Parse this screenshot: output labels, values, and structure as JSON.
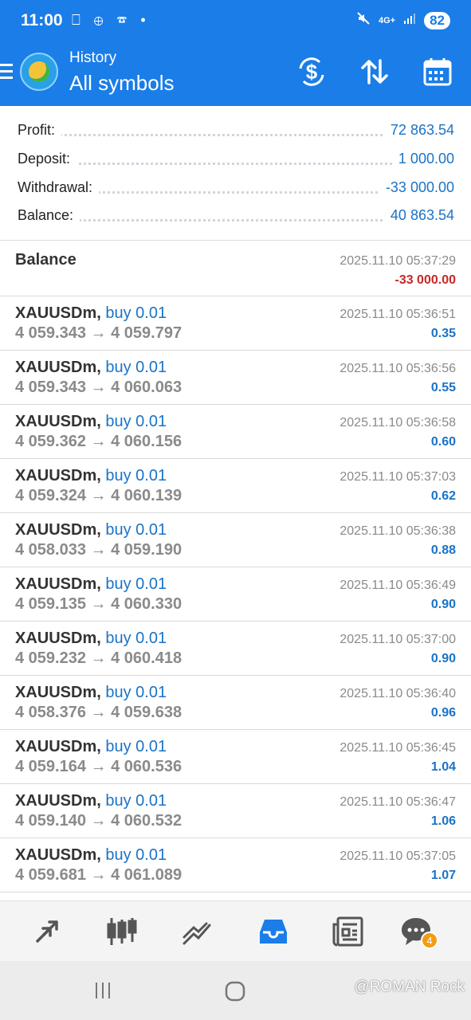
{
  "status_bar": {
    "time": "11:00",
    "left_icons": "⎕ ⊕ ☎ •",
    "network": "4G+",
    "battery": "82"
  },
  "header": {
    "title": "History",
    "subtitle": "All symbols",
    "background_color": "#1a7de8"
  },
  "summary": [
    {
      "label": "Profit:",
      "value": "72 863.54"
    },
    {
      "label": "Deposit:",
      "value": "1 000.00"
    },
    {
      "label": "Withdrawal:",
      "value": "-33 000.00"
    },
    {
      "label": "Balance:",
      "value": "40 863.54"
    }
  ],
  "balance_entry": {
    "label": "Balance",
    "datetime": "2025.11.10 05:37:29",
    "amount": "-33 000.00"
  },
  "deals": [
    {
      "symbol": "XAUUSDm,",
      "direction_lot": "buy 0.01",
      "prices": "4 059.343 → 4 059.797",
      "datetime": "2025.11.10 05:36:51",
      "profit": "0.35"
    },
    {
      "symbol": "XAUUSDm,",
      "direction_lot": "buy 0.01",
      "prices": "4 059.343 → 4 060.063",
      "datetime": "2025.11.10 05:36:56",
      "profit": "0.55"
    },
    {
      "symbol": "XAUUSDm,",
      "direction_lot": "buy 0.01",
      "prices": "4 059.362 → 4 060.156",
      "datetime": "2025.11.10 05:36:58",
      "profit": "0.60"
    },
    {
      "symbol": "XAUUSDm,",
      "direction_lot": "buy 0.01",
      "prices": "4 059.324 → 4 060.139",
      "datetime": "2025.11.10 05:37:03",
      "profit": "0.62"
    },
    {
      "symbol": "XAUUSDm,",
      "direction_lot": "buy 0.01",
      "prices": "4 058.033 → 4 059.190",
      "datetime": "2025.11.10 05:36:38",
      "profit": "0.88"
    },
    {
      "symbol": "XAUUSDm,",
      "direction_lot": "buy 0.01",
      "prices": "4 059.135 → 4 060.330",
      "datetime": "2025.11.10 05:36:49",
      "profit": "0.90"
    },
    {
      "symbol": "XAUUSDm,",
      "direction_lot": "buy 0.01",
      "prices": "4 059.232 → 4 060.418",
      "datetime": "2025.11.10 05:37:00",
      "profit": "0.90"
    },
    {
      "symbol": "XAUUSDm,",
      "direction_lot": "buy 0.01",
      "prices": "4 058.376 → 4 059.638",
      "datetime": "2025.11.10 05:36:40",
      "profit": "0.96"
    },
    {
      "symbol": "XAUUSDm,",
      "direction_lot": "buy 0.01",
      "prices": "4 059.164 → 4 060.536",
      "datetime": "2025.11.10 05:36:45",
      "profit": "1.04"
    },
    {
      "symbol": "XAUUSDm,",
      "direction_lot": "buy 0.01",
      "prices": "4 059.140 → 4 060.532",
      "datetime": "2025.11.10 05:36:47",
      "profit": "1.06"
    },
    {
      "symbol": "XAUUSDm,",
      "direction_lot": "buy 0.01",
      "prices": "4 059.681 → 4 061.089",
      "datetime": "2025.11.10 05:37:05",
      "profit": "1.07"
    }
  ],
  "bottom_nav": {
    "items": [
      "quotes-icon",
      "chart-icon",
      "trade-icon",
      "history-icon",
      "news-icon",
      "messages-icon"
    ],
    "active": "history-icon",
    "messages_badge": "4",
    "active_color": "#1a7de8",
    "badge_color": "#f39c12"
  },
  "watermark": "@ROMAN Rock"
}
